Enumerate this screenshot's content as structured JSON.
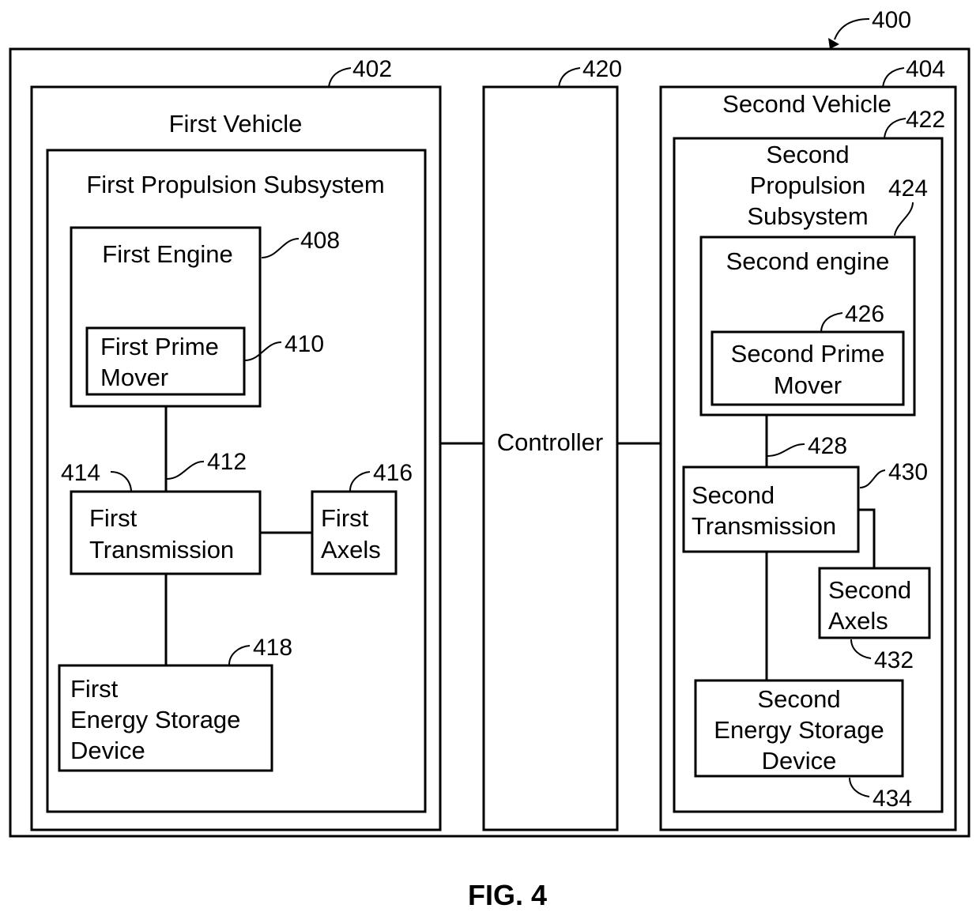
{
  "figure": {
    "caption": "FIG. 4",
    "ref": "400"
  },
  "blocks": {
    "first_vehicle": {
      "ref": "402",
      "lines": [
        "First Vehicle"
      ]
    },
    "first_propulsion": {
      "lines": [
        "First Propulsion Subsystem"
      ]
    },
    "first_engine": {
      "ref": "408",
      "lines": [
        "First Engine"
      ]
    },
    "first_prime_mover": {
      "ref": "410",
      "lines": [
        "First Prime",
        "Mover"
      ]
    },
    "first_transmission": {
      "ref": "414",
      "lines": [
        "First",
        "Transmission"
      ]
    },
    "first_axels": {
      "ref": "416",
      "lines": [
        "First",
        "Axels"
      ]
    },
    "first_energy_storage": {
      "ref": "418",
      "lines": [
        "First",
        "Energy Storage",
        "Device"
      ]
    },
    "controller": {
      "ref": "420",
      "lines": [
        "Controller"
      ]
    },
    "second_vehicle": {
      "ref": "404",
      "lines": [
        "Second Vehicle"
      ]
    },
    "second_propulsion": {
      "ref": "422",
      "lines": [
        "Second",
        "Propulsion",
        "Subsystem"
      ]
    },
    "second_engine": {
      "ref": "424",
      "lines": [
        "Second engine"
      ]
    },
    "second_prime_mover": {
      "ref": "426",
      "lines": [
        "Second Prime",
        "Mover"
      ]
    },
    "second_transmission": {
      "ref": "430",
      "lines": [
        "Second",
        "Transmission"
      ]
    },
    "second_axels": {
      "ref": "432",
      "lines": [
        "Second",
        "Axels"
      ]
    },
    "second_energy_storage": {
      "ref": "434",
      "lines": [
        "Second",
        "Energy Storage",
        "Device"
      ]
    }
  },
  "connections": {
    "first_shaft": {
      "ref": "412"
    },
    "second_shaft": {
      "ref": "428"
    }
  }
}
